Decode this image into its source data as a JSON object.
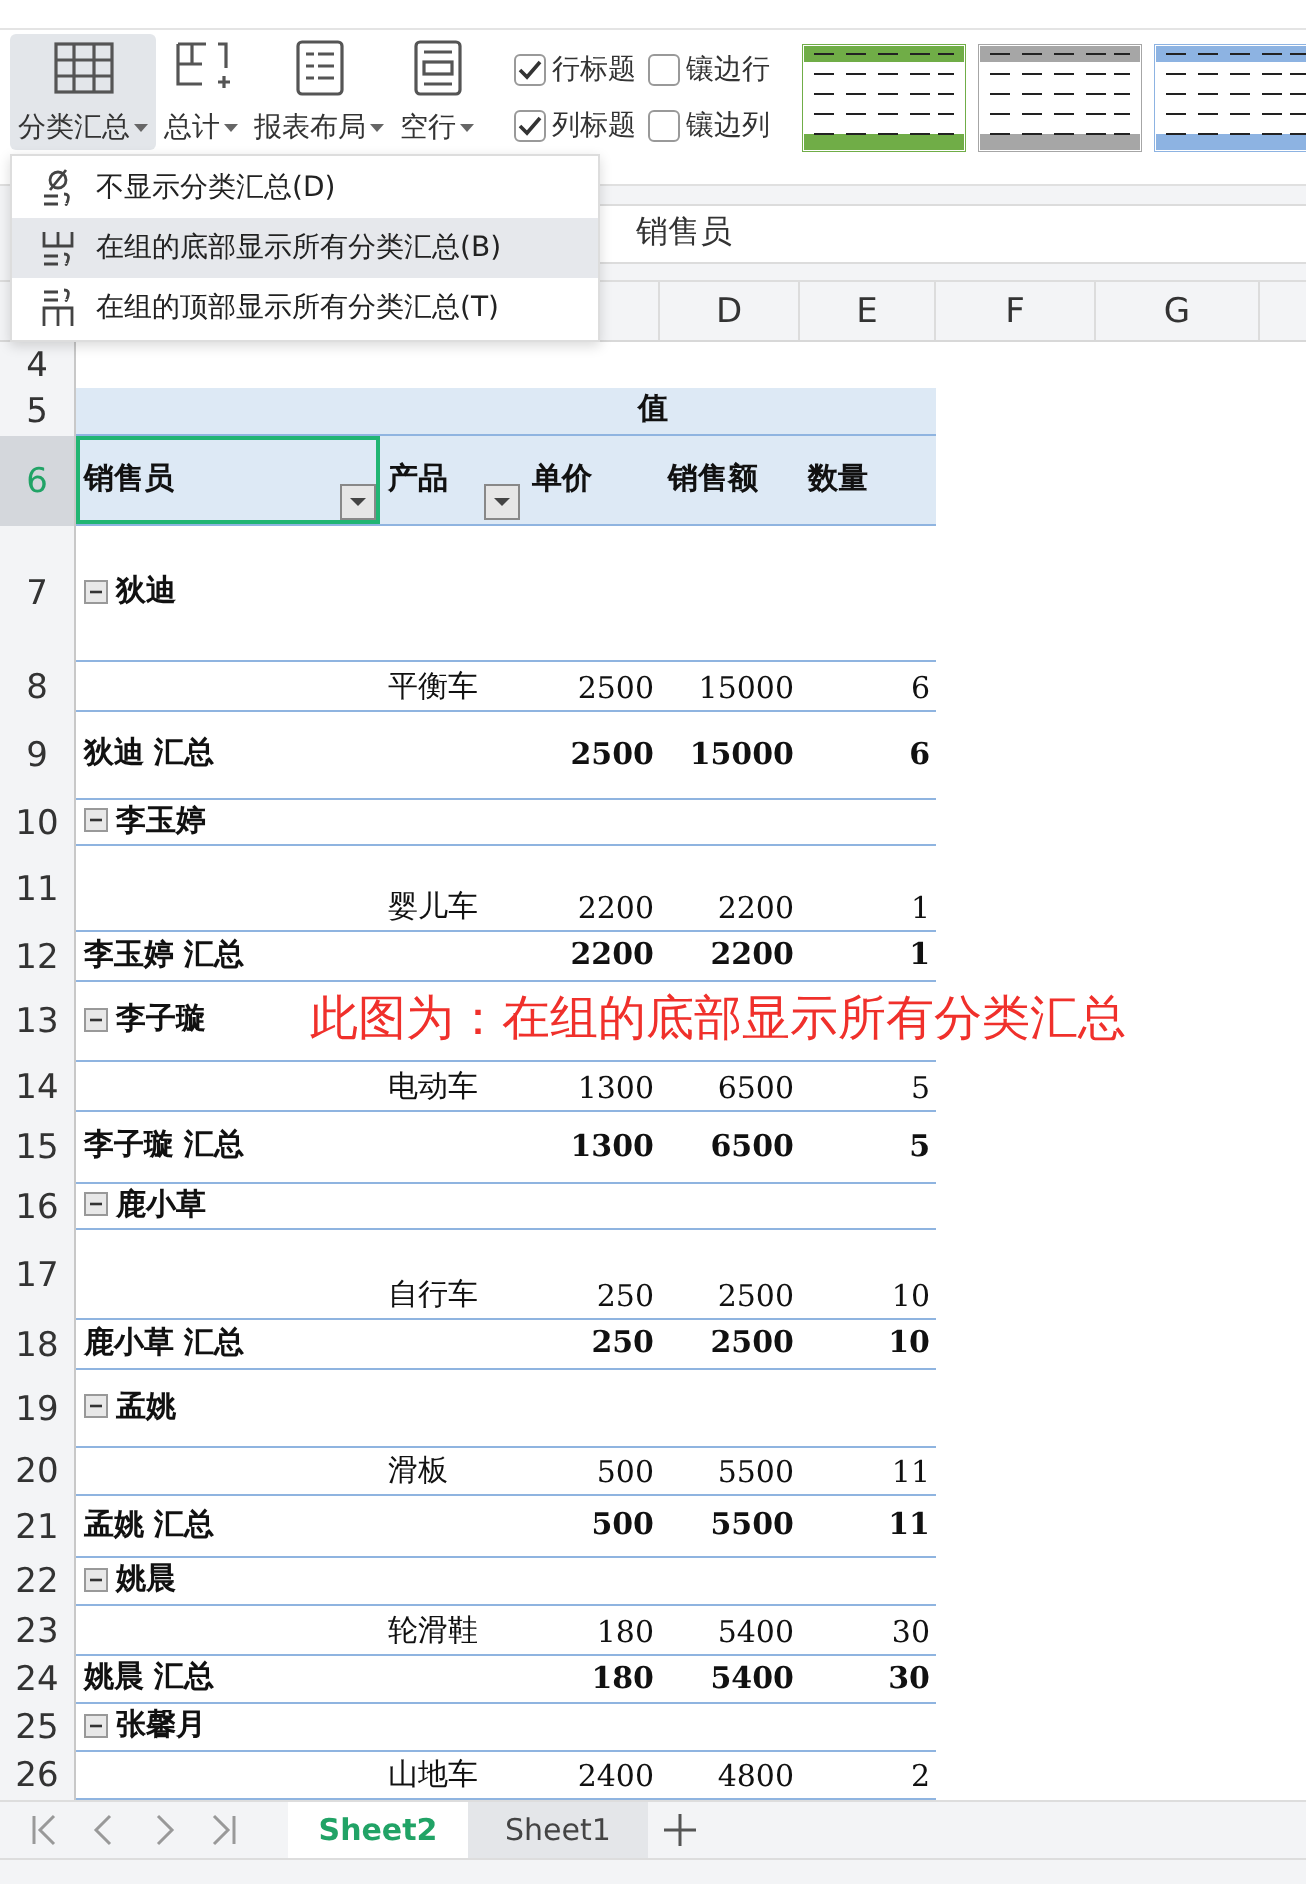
{
  "ribbon": {
    "buttons": [
      {
        "label": "分类汇总",
        "kind": "subtotal",
        "selected": true
      },
      {
        "label": "总计",
        "kind": "total",
        "selected": false
      },
      {
        "label": "报表布局",
        "kind": "layout",
        "selected": false
      },
      {
        "label": "空行",
        "kind": "blank",
        "selected": false
      }
    ],
    "checkboxes": [
      {
        "label": "行标题",
        "checked": true
      },
      {
        "label": "镶边行",
        "checked": false
      },
      {
        "label": "列标题",
        "checked": true
      },
      {
        "label": "镶边列",
        "checked": false
      }
    ],
    "styles": [
      {
        "color": "#70ad47"
      },
      {
        "color": "#a6a6a6"
      },
      {
        "color": "#8db3e2"
      }
    ]
  },
  "menu": {
    "items": [
      {
        "label": "不显示分类汇总(D)",
        "kind": "none",
        "selected": false
      },
      {
        "label": "在组的底部显示所有分类汇总(B)",
        "kind": "bottom",
        "selected": true
      },
      {
        "label": "在组的顶部显示所有分类汇总(T)",
        "kind": "top",
        "selected": false
      }
    ]
  },
  "formula_bar": {
    "value": "销售员"
  },
  "columns": [
    "D",
    "E",
    "F",
    "G"
  ],
  "rows": [
    {
      "number": "4",
      "kind": "blank",
      "selected": false
    },
    {
      "number": "5",
      "kind": "values",
      "selected": false,
      "values_label": "值"
    },
    {
      "number": "6",
      "kind": "header",
      "selected": true,
      "cells": [
        "销售员",
        "产品",
        "单价",
        "销售额",
        "数量"
      ]
    },
    {
      "number": "7",
      "kind": "group",
      "selected": false,
      "label": "狄迪",
      "expanded": true
    },
    {
      "number": "8",
      "kind": "item",
      "selected": false,
      "cells": [
        "平衡车",
        "2500",
        "15000",
        "6"
      ]
    },
    {
      "number": "9",
      "kind": "subtotal",
      "selected": false,
      "cells": [
        "狄迪 汇总",
        "2500",
        "15000",
        "6"
      ]
    },
    {
      "number": "10",
      "kind": "group",
      "selected": false,
      "label": "李玉婷",
      "expanded": true
    },
    {
      "number": "11",
      "kind": "item",
      "selected": false,
      "cells": [
        "婴儿车",
        "2200",
        "2200",
        "1"
      ]
    },
    {
      "number": "12",
      "kind": "subtotal",
      "selected": false,
      "cells": [
        "李玉婷 汇总",
        "2200",
        "2200",
        "1"
      ]
    },
    {
      "number": "13",
      "kind": "group",
      "selected": false,
      "label": "李子璇",
      "expanded": true
    },
    {
      "number": "14",
      "kind": "item",
      "selected": false,
      "cells": [
        "电动车",
        "1300",
        "6500",
        "5"
      ]
    },
    {
      "number": "15",
      "kind": "subtotal",
      "selected": false,
      "cells": [
        "李子璇 汇总",
        "1300",
        "6500",
        "5"
      ]
    },
    {
      "number": "16",
      "kind": "group",
      "selected": false,
      "label": "鹿小草",
      "expanded": true
    },
    {
      "number": "17",
      "kind": "item",
      "selected": false,
      "cells": [
        "自行车",
        "250",
        "2500",
        "10"
      ]
    },
    {
      "number": "18",
      "kind": "subtotal",
      "selected": false,
      "cells": [
        "鹿小草 汇总",
        "250",
        "2500",
        "10"
      ]
    },
    {
      "number": "19",
      "kind": "group",
      "selected": false,
      "label": "孟姚",
      "expanded": true
    },
    {
      "number": "20",
      "kind": "item",
      "selected": false,
      "cells": [
        "滑板",
        "500",
        "5500",
        "11"
      ]
    },
    {
      "number": "21",
      "kind": "subtotal",
      "selected": false,
      "cells": [
        "孟姚 汇总",
        "500",
        "5500",
        "11"
      ]
    },
    {
      "number": "22",
      "kind": "group",
      "selected": false,
      "label": "姚晨",
      "expanded": true
    },
    {
      "number": "23",
      "kind": "item",
      "selected": false,
      "cells": [
        "轮滑鞋",
        "180",
        "5400",
        "30"
      ]
    },
    {
      "number": "24",
      "kind": "subtotal",
      "selected": false,
      "cells": [
        "姚晨 汇总",
        "180",
        "5400",
        "30"
      ]
    },
    {
      "number": "25",
      "kind": "group",
      "selected": false,
      "label": "张馨月",
      "expanded": true
    },
    {
      "number": "26",
      "kind": "item",
      "selected": false,
      "cells": [
        "山地车",
        "2400",
        "4800",
        "2"
      ]
    }
  ],
  "annotation": "此图为：在组的底部显示所有分类汇总",
  "sheet_tabs": [
    {
      "label": "Sheet2",
      "selected": true
    },
    {
      "label": "Sheet1",
      "selected": false
    }
  ]
}
